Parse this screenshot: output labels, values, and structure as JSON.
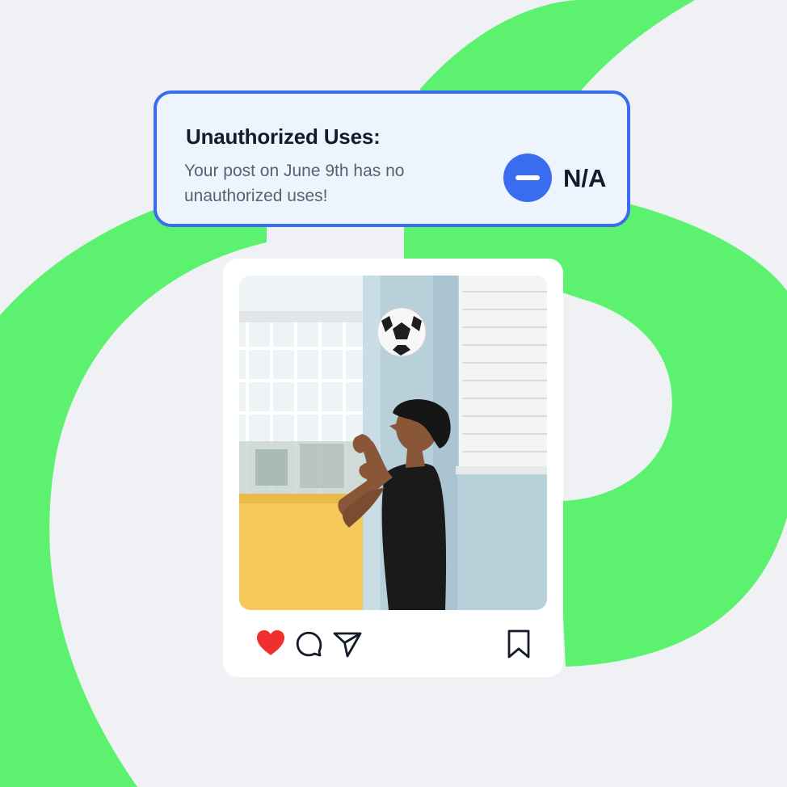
{
  "alert": {
    "title": "Unauthorized Uses:",
    "message": "Your post on June 9th has no unauthorized uses!",
    "status_value": "N/A",
    "status_icon": "minus-circle-icon",
    "accent_color": "#3a6cf0"
  },
  "post": {
    "image_alt": "Young man in black t-shirt heading a soccer ball in front of a light blue wall",
    "actions": [
      {
        "icon": "heart-icon",
        "state": "liked",
        "color": "#f0302f"
      },
      {
        "icon": "comment-icon"
      },
      {
        "icon": "send-icon"
      },
      {
        "icon": "bookmark-icon"
      }
    ]
  },
  "colors": {
    "background": "#eff1f4",
    "swoosh": "#5cf270",
    "card": "#ffffff"
  }
}
